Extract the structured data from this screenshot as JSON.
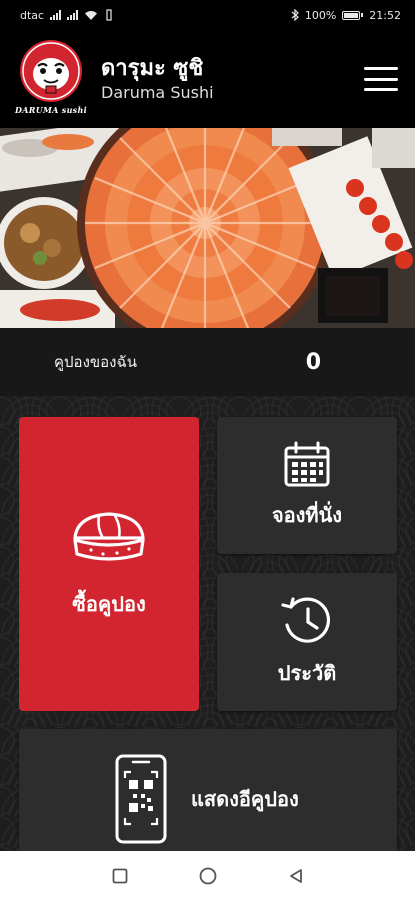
{
  "status_bar": {
    "carrier": "dtac",
    "battery": "100%",
    "time": "21:52"
  },
  "header": {
    "title_thai": "ดารุมะ ซูชิ",
    "title_en": "Daruma Sushi",
    "logo_text": "DARUMA sushi"
  },
  "coupons": {
    "label": "คูปองของฉัน",
    "count": "0"
  },
  "tiles": {
    "buy_coupon": "ซื้อคูปอง",
    "reserve": "จองที่นั่ง",
    "history": "ประวัติ",
    "show_ecoupon": "แสดงอีคูปอง"
  },
  "colors": {
    "accent_red": "#d32530",
    "tile_dark": "#2d2d2d",
    "header_bg": "#000000"
  },
  "icons": [
    "signal-icon",
    "wifi-icon",
    "bluetooth-icon",
    "battery-icon",
    "hamburger-menu-icon",
    "sushi-icon",
    "calendar-icon",
    "history-clock-icon",
    "phone-qr-icon",
    "square-nav-icon",
    "circle-nav-icon",
    "triangle-back-icon"
  ]
}
